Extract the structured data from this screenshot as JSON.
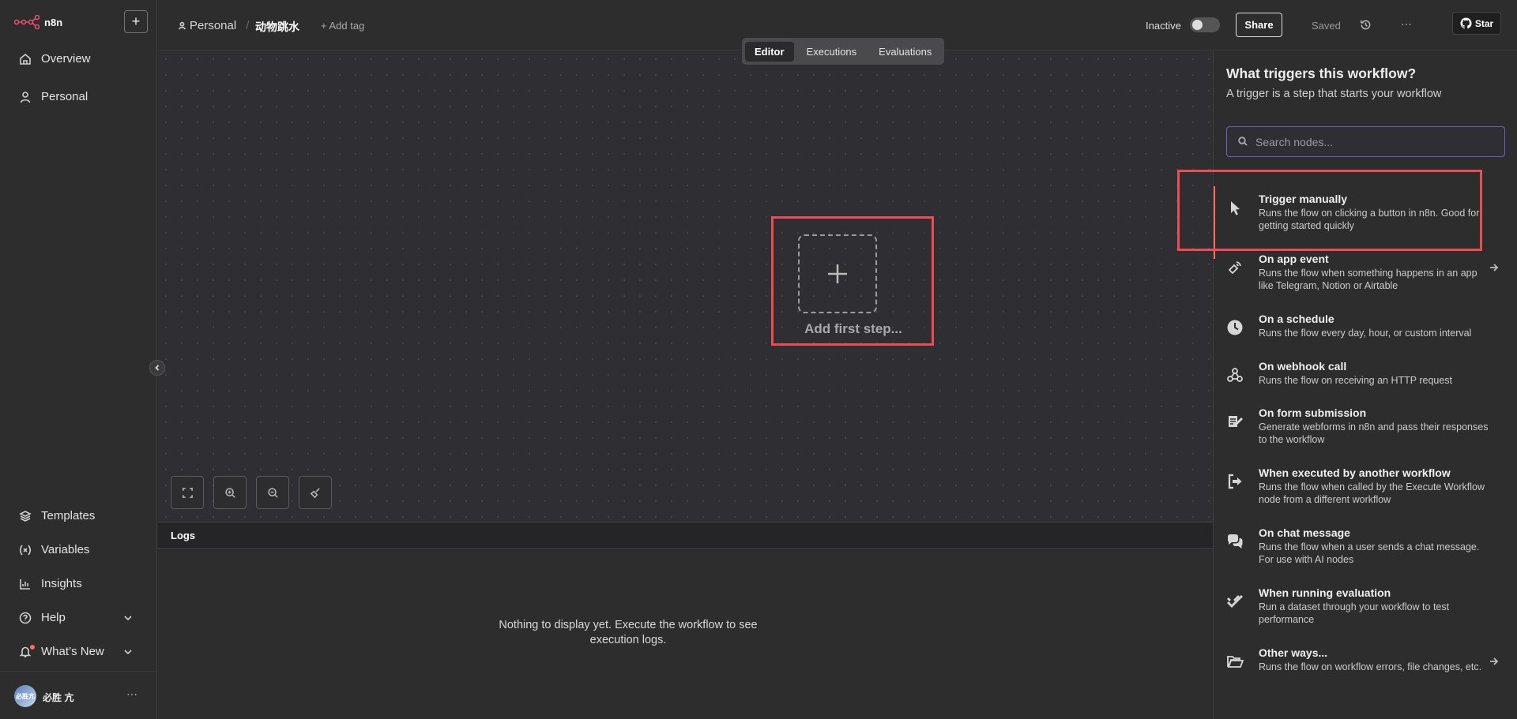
{
  "app": {
    "logo_text": "n8n"
  },
  "sidebar": {
    "items": [
      {
        "label": "Overview"
      },
      {
        "label": "Personal"
      }
    ],
    "bottom_items": [
      {
        "label": "Templates"
      },
      {
        "label": "Variables"
      },
      {
        "label": "Insights"
      },
      {
        "label": "Help"
      },
      {
        "label": "What’s New"
      }
    ],
    "user": {
      "name": "必胜 亢",
      "avatar_text": "必胜亢"
    }
  },
  "header": {
    "project": "Personal",
    "workflow_name": "动物跳水",
    "add_tag": "+ Add tag",
    "status_label": "Inactive",
    "share_label": "Share",
    "saved_label": "Saved",
    "more_label": "···",
    "star_label": "Star"
  },
  "tabs": [
    {
      "label": "Editor",
      "active": true
    },
    {
      "label": "Executions",
      "active": false
    },
    {
      "label": "Evaluations",
      "active": false
    }
  ],
  "canvas": {
    "add_first_step": "Add first step..."
  },
  "logs": {
    "title": "Logs",
    "empty": "Nothing to display yet. Execute the workflow to see execution logs."
  },
  "panel": {
    "title": "What triggers this workflow?",
    "subtitle": "A trigger is a step that starts your workflow",
    "search_placeholder": "Search nodes...",
    "items": [
      {
        "title": "Trigger manually",
        "desc": "Runs the flow on clicking a button in n8n. Good for getting started quickly",
        "icon": "cursor-icon"
      },
      {
        "title": "On app event",
        "desc": "Runs the flow when something happens in an app like Telegram, Notion or Airtable",
        "icon": "satellite-icon"
      },
      {
        "title": "On a schedule",
        "desc": "Runs the flow every day, hour, or custom interval",
        "icon": "clock-icon"
      },
      {
        "title": "On webhook call",
        "desc": "Runs the flow on receiving an HTTP request",
        "icon": "webhook-icon"
      },
      {
        "title": "On form submission",
        "desc": "Generate webforms in n8n and pass their responses to the workflow",
        "icon": "form-icon"
      },
      {
        "title": "When executed by another workflow",
        "desc": "Runs the flow when called by the Execute Workflow node from a different workflow",
        "icon": "sign-in-icon"
      },
      {
        "title": "On chat message",
        "desc": "Runs the flow when a user sends a chat message. For use with AI nodes",
        "icon": "chat-icon"
      },
      {
        "title": "When running evaluation",
        "desc": "Run a dataset through your workflow to test performance",
        "icon": "check-double-icon"
      },
      {
        "title": "Other ways...",
        "desc": "Runs the flow on workflow errors, file changes, etc.",
        "icon": "folder-open-icon"
      }
    ]
  },
  "colors": {
    "accent": "#ff6d5a",
    "highlight": "#ef4b52",
    "search_border": "#6c5ec9"
  }
}
